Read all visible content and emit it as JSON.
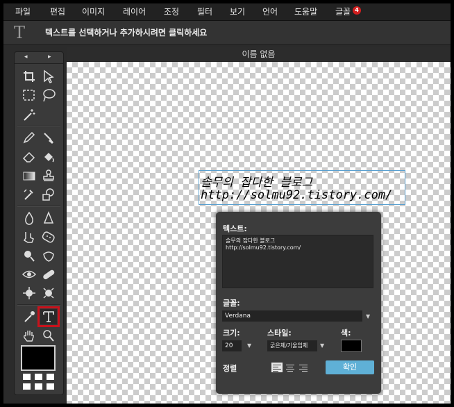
{
  "menubar": {
    "items": [
      "파일",
      "편집",
      "이미지",
      "레이어",
      "조정",
      "필터",
      "보기",
      "언어",
      "도움말",
      "글꼴"
    ],
    "font_badge": "4"
  },
  "options_bar": {
    "tool_icon": "text-tool-icon",
    "hint": "텍스트를 선택하거나 추가하시려면 클릭하세요"
  },
  "toolbox": {
    "nav_left": "◂",
    "nav_right": "▸",
    "active_tool": "text-tool",
    "tools": [
      "crop",
      "move",
      "marquee",
      "lasso",
      "magic-wand",
      "pencil",
      "brush",
      "eraser",
      "fill",
      "gradient",
      "clone-stamp",
      "color-replace",
      "shape",
      "blur",
      "sharpen",
      "smudge",
      "sponge",
      "dodge",
      "burn",
      "red-eye",
      "spot-heal",
      "bloat",
      "pinch",
      "eyedropper",
      "text",
      "hand",
      "zoom"
    ],
    "foreground_color": "#000000"
  },
  "document": {
    "title": "이름 없음",
    "text_line_1": "솔무의 잡다한 블로그",
    "text_line_2": "http://solmu92.tistory.com/"
  },
  "text_dialog": {
    "text_label": "텍스트:",
    "text_value_line_1": "솔무의 잡다한 블로그",
    "text_value_line_2": "http://solmu92.tistory.com/",
    "font_label": "글꼴:",
    "font_value": "Verdana",
    "size_label": "크기:",
    "size_value": "20",
    "style_label": "스타일:",
    "style_value": "굵은체/기울임체",
    "color_label": "색:",
    "color_value": "#000000",
    "align_label": "정렬",
    "ok_label": "확인"
  },
  "colors": {
    "accent": "#5fb0d6",
    "highlight": "#c8121c",
    "badge": "#d21f1f"
  }
}
